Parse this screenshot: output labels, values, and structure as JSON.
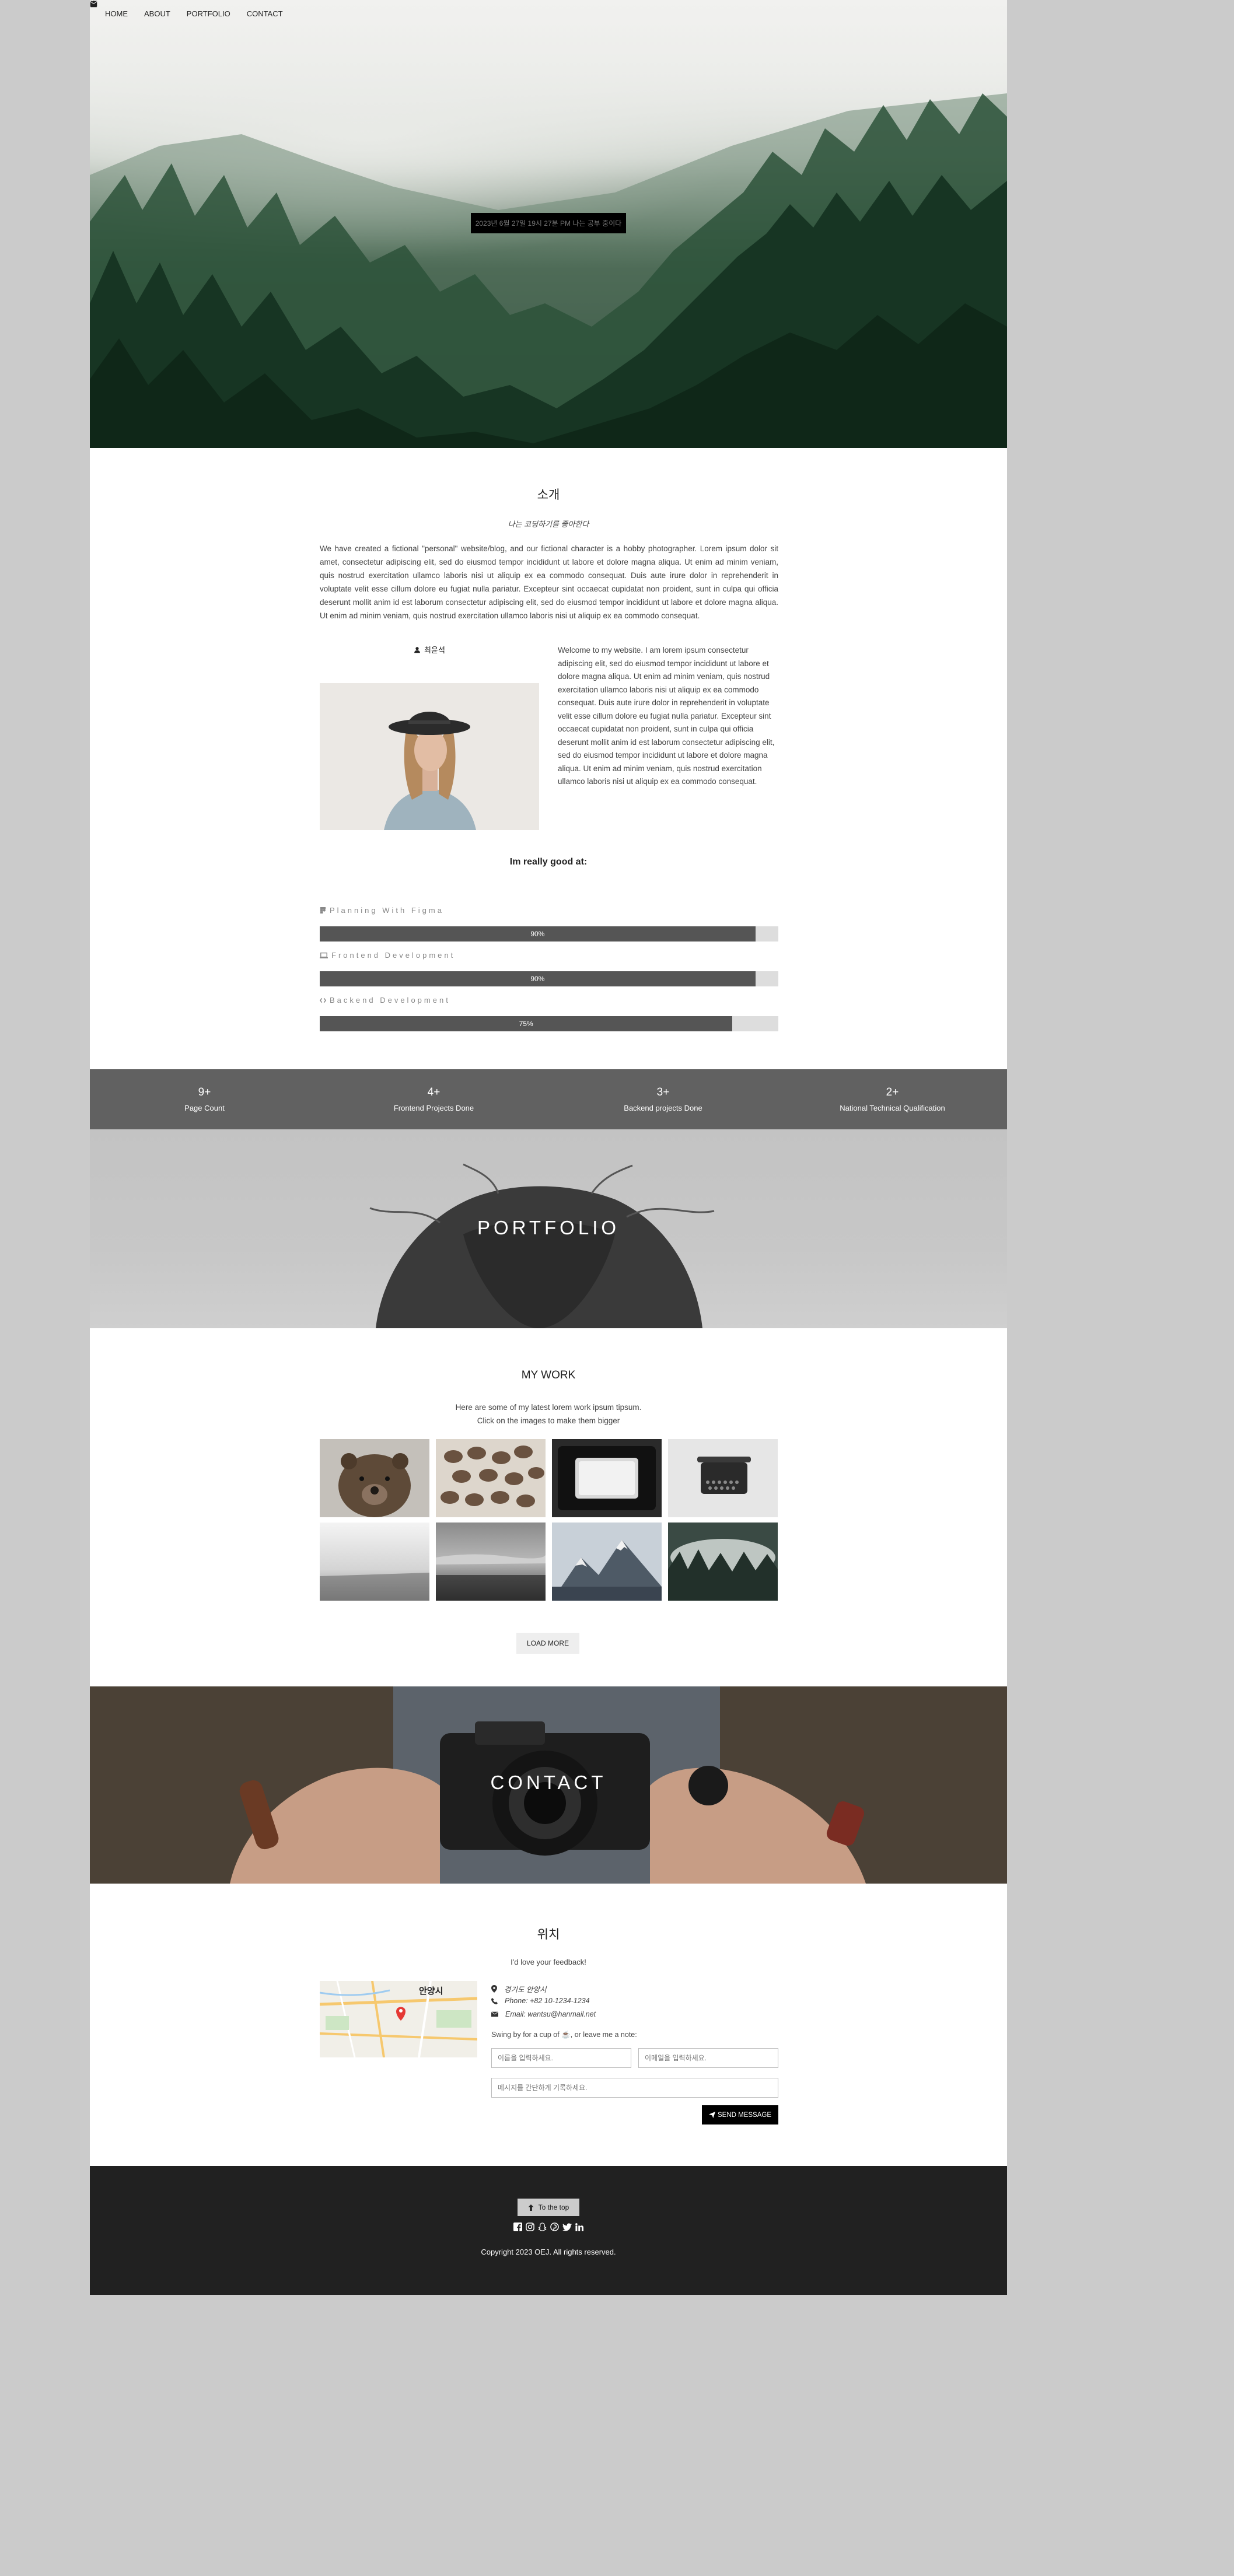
{
  "nav": {
    "items": [
      {
        "label": "HOME",
        "icon": ""
      },
      {
        "label": "ABOUT",
        "icon": "user-icon"
      },
      {
        "label": "PORTFOLIO",
        "icon": "th-icon"
      },
      {
        "label": "CONTACT",
        "icon": "envelope-icon"
      }
    ]
  },
  "hero": {
    "banner_text": "2023년 6월 27일 19시 27분 PM 나는 공부 중이다"
  },
  "intro": {
    "title": "소개",
    "subtitle": "나는 코딩하기를 좋아한다",
    "paragraph": "We have created a fictional \"personal\" website/blog, and our fictional character is a hobby photographer. Lorem ipsum dolor sit amet, consectetur adipiscing elit, sed do eiusmod tempor incididunt ut labore et dolore magna aliqua. Ut enim ad minim veniam, quis nostrud exercitation ullamco laboris nisi ut aliquip ex ea commodo consequat. Duis aute irure dolor in reprehenderit in voluptate velit esse cillum dolore eu fugiat nulla pariatur. Excepteur sint occaecat cupidatat non proident, sunt in culpa qui officia deserunt mollit anim id est laborum consectetur adipiscing elit, sed do eiusmod tempor incididunt ut labore et dolore magna aliqua. Ut enim ad minim veniam, quis nostrud exercitation ullamco laboris nisi ut aliquip ex ea commodo consequat."
  },
  "profile": {
    "name": "최윤석",
    "text": "Welcome to my website. I am lorem ipsum consectetur adipiscing elit, sed do eiusmod tempor incididunt ut labore et dolore magna aliqua. Ut enim ad minim veniam, quis nostrud exercitation ullamco laboris nisi ut aliquip ex ea commodo consequat. Duis aute irure dolor in reprehenderit in voluptate velit esse cillum dolore eu fugiat nulla pariatur. Excepteur sint occaecat cupidatat non proident, sunt in culpa qui officia deserunt mollit anim id est laborum consectetur adipiscing elit, sed do eiusmod tempor incididunt ut labore et dolore magna aliqua. Ut enim ad minim veniam, quis nostrud exercitation ullamco laboris nisi ut aliquip ex ea commodo consequat."
  },
  "skills": {
    "heading": "Im really good at:",
    "items": [
      {
        "label": "Planning With Figma",
        "percent": 95,
        "percent_label": "90%",
        "icon": "figma-icon"
      },
      {
        "label": "Frontend Development",
        "percent": 95,
        "percent_label": "90%",
        "icon": "laptop-icon"
      },
      {
        "label": "Backend Development",
        "percent": 90,
        "percent_label": "75%",
        "icon": "code-icon"
      }
    ]
  },
  "stats": [
    {
      "number": "9+",
      "label": "Page Count"
    },
    {
      "number": "4+",
      "label": "Frontend Projects Done"
    },
    {
      "number": "3+",
      "label": "Backend projects Done"
    },
    {
      "number": "2+",
      "label": "National Technical Qualification"
    }
  ],
  "portfolio": {
    "banner_title": "PORTFOLIO",
    "work_title": "MY WORK",
    "work_line1": "Here are some of my latest lorem work ipsum tipsum.",
    "work_line2": "Click on the images to make them bigger",
    "load_more": "LOAD MORE"
  },
  "contact": {
    "banner_title": "CONTACT",
    "location_title": "위치",
    "feedback": "I'd love your feedback!",
    "address": "경기도 안양시",
    "phone": "Phone: +82 10-1234-1234",
    "email": "Email: wantsu@hanmail.net",
    "swing_text": "Swing by for a cup of ☕, or leave me a note:",
    "name_placeholder": "이름을 입력하세요.",
    "email_placeholder": "이메일을 입력하세요.",
    "message_placeholder": "메시지를 간단하게 기록하세요.",
    "send_label": "SEND MESSAGE",
    "map_city_label": "안양시"
  },
  "footer": {
    "to_top": "To the top",
    "copyright": "Copyright 2023 OEJ. All rights reserved."
  },
  "colors": {
    "stats_bg": "#616161",
    "skill_fill": "#555555",
    "footer_bg": "#212121",
    "page_bg": "#cbcbcb"
  }
}
